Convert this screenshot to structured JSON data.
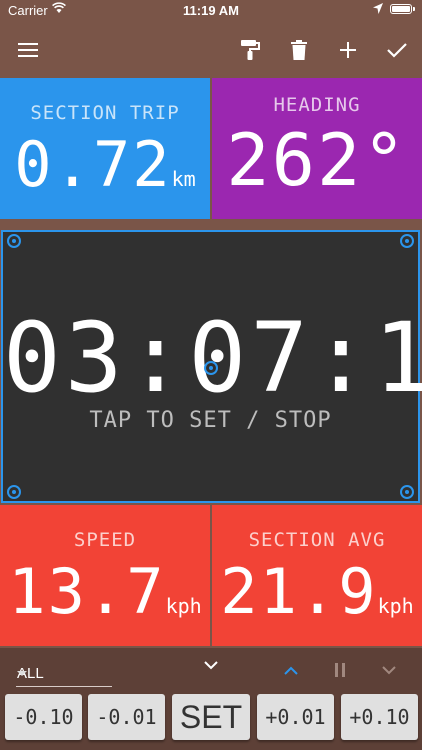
{
  "status_bar": {
    "carrier": "Carrier",
    "time": "11:19 AM"
  },
  "toolbar": {
    "icons": [
      "menu-icon",
      "paint-roller-icon",
      "trash-icon",
      "add-icon",
      "check-icon"
    ]
  },
  "tiles": {
    "section_trip": {
      "label": "SECTION TRIP",
      "value": "0.72",
      "unit": "km",
      "color": "#2b95ec"
    },
    "heading": {
      "label": "HEADING",
      "value": "262°",
      "color": "#9b27b0"
    },
    "speed": {
      "label": "SPEED",
      "value": "13.7",
      "unit": "kph",
      "color": "#f24336"
    },
    "section_avg": {
      "label": "SECTION AVG",
      "value": "21.9",
      "unit": "kph",
      "color": "#f24336"
    }
  },
  "timer": {
    "value": "03:07:1",
    "hint": "TAP TO SET / STOP",
    "color": "#303030",
    "accent": "#2b95ec"
  },
  "controls": {
    "filter": {
      "selected": "ALL"
    },
    "adjust_buttons": [
      "-0.10",
      "-0.01",
      "SET",
      "+0.01",
      "+0.10"
    ]
  },
  "colors": {
    "toolbar": "#7a5548",
    "bottom_bar": "#5d4037",
    "button": "#e0e0e0"
  }
}
